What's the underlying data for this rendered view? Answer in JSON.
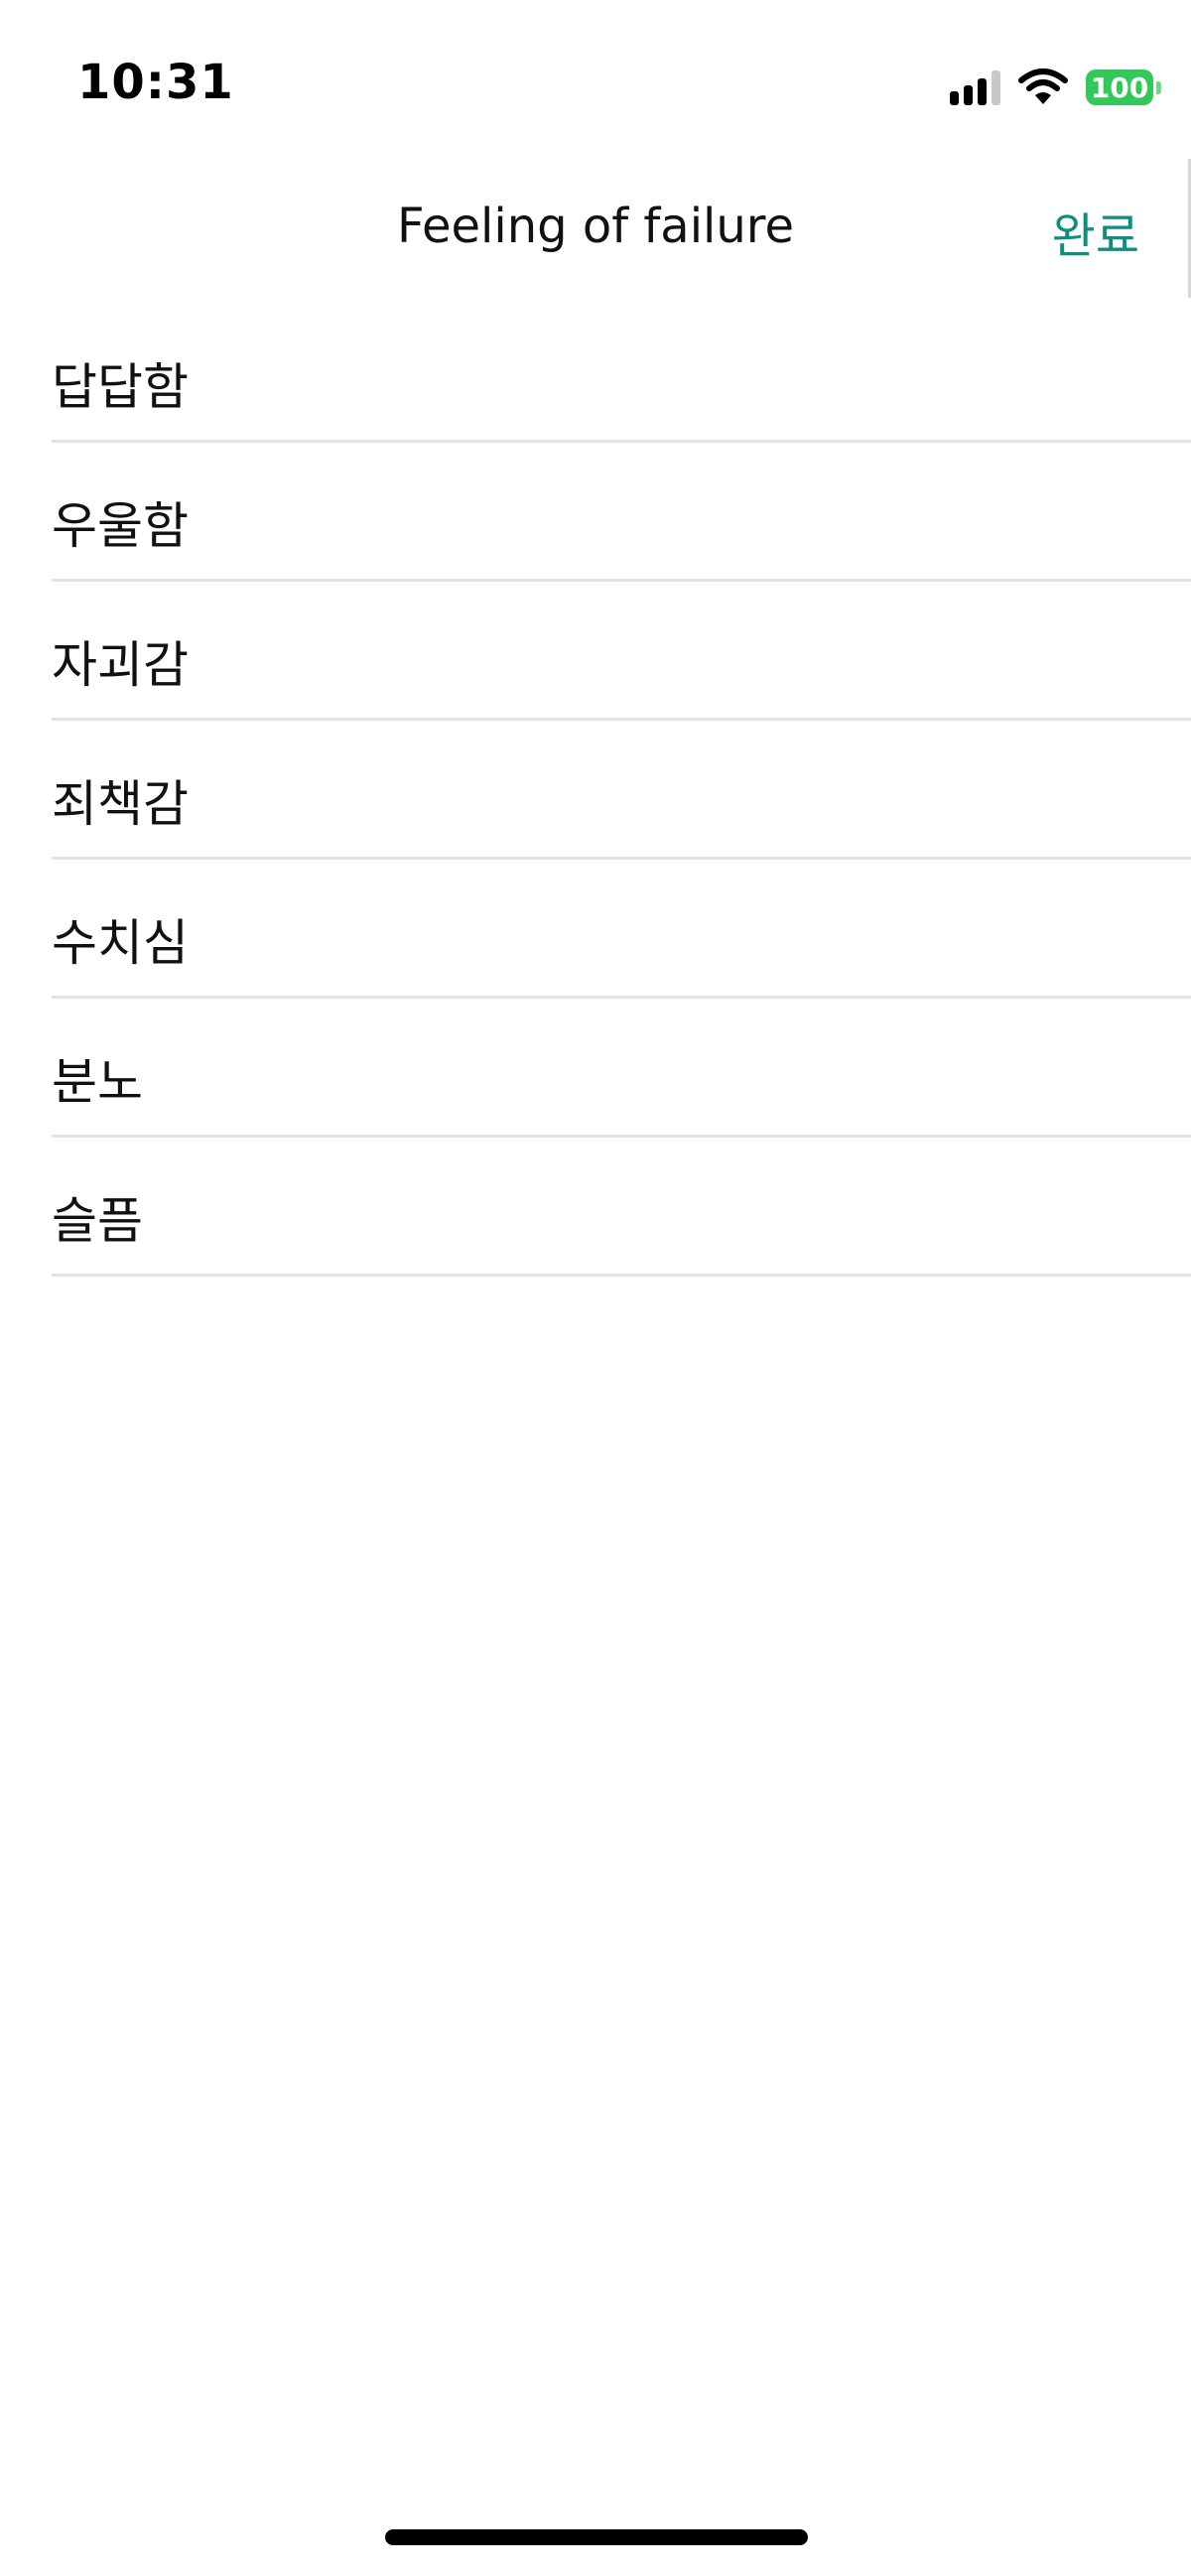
{
  "status_bar": {
    "time": "10:31",
    "battery": "100",
    "icons": [
      "signal-icon",
      "wifi-icon",
      "battery-icon"
    ]
  },
  "nav": {
    "title": "Feeling of failure",
    "done_label": "완료"
  },
  "list": {
    "items": [
      {
        "label": "답답함"
      },
      {
        "label": "우울함"
      },
      {
        "label": "자괴감"
      },
      {
        "label": "죄책감"
      },
      {
        "label": "수치심"
      },
      {
        "label": "분노"
      },
      {
        "label": "슬픔"
      }
    ]
  },
  "colors": {
    "accent": "#0e8f7e",
    "battery": "#34c759",
    "separator": "#e2e2e2"
  }
}
